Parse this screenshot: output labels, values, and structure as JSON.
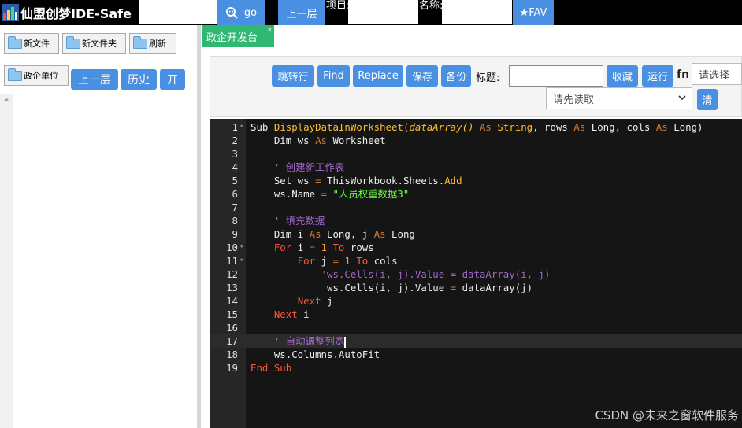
{
  "topbar": {
    "app_title": "仙盟创梦IDE-Safe",
    "go_label": "go",
    "up_label": "上一层",
    "project_label": "项目:",
    "name_label": "名称:",
    "fav_label": "★FAV",
    "search_value": "",
    "project_value": "",
    "name_value": ""
  },
  "sidebar": {
    "new_file": "新文件",
    "new_folder": "新文件夹",
    "refresh": "刷新",
    "folder_item": "政企单位",
    "up_level": "上一层",
    "history": "历史",
    "open": "开"
  },
  "tab": {
    "label": "政企开发台"
  },
  "toolbar": {
    "goto_line": "跳转行",
    "find": "Find",
    "replace": "Replace",
    "save": "保存",
    "backup": "备份",
    "title_label": "标题:",
    "title_value": "",
    "favorite": "收藏",
    "run": "运行",
    "fn": "fn",
    "select_placeholder": "请选择",
    "read_placeholder": "请先读取",
    "clear": "清"
  },
  "editor": {
    "active_line": 17,
    "lines": [
      {
        "n": "1",
        "fold": "▾"
      },
      {
        "n": "2"
      },
      {
        "n": "3"
      },
      {
        "n": "4"
      },
      {
        "n": "5"
      },
      {
        "n": "6"
      },
      {
        "n": "7"
      },
      {
        "n": "8"
      },
      {
        "n": "9"
      },
      {
        "n": "10",
        "fold": "▾"
      },
      {
        "n": "11",
        "fold": "▾"
      },
      {
        "n": "12"
      },
      {
        "n": "13"
      },
      {
        "n": "14"
      },
      {
        "n": "15"
      },
      {
        "n": "16"
      },
      {
        "n": "17"
      },
      {
        "n": "18"
      },
      {
        "n": "19"
      }
    ],
    "code": {
      "l1_sub": "Sub",
      "l1_name": "DisplayDataInWorksheet(",
      "l1_param": "dataArray()",
      "l1_as1": "As",
      "l1_type1": "String",
      "l1_rows": ", rows ",
      "l1_as2": "As",
      "l1_type2": "Long",
      "l1_cols": ", cols ",
      "l1_as3": "As",
      "l1_type3": "Long)",
      "l2_dim": "Dim ws ",
      "l2_as": "As",
      "l2_type": "Worksheet",
      "l4_comment": "' 创建新工作表",
      "l5_set": "Set ws ",
      "l5_eq": "=",
      "l5_obj": " ThisWorkbook.Sheets.",
      "l5_add": "Add",
      "l6_ws": "ws.Name ",
      "l6_eq": "=",
      "l6_str": " \"人员权重数据3\"",
      "l8_comment": "' 填充数据",
      "l9_dim": "Dim i ",
      "l9_as1": "As",
      "l9_mid": " Long, j ",
      "l9_as2": "As",
      "l9_end": " Long",
      "l10_for": "For",
      "l10_i": " i ",
      "l10_eq": "=",
      "l10_one": " 1",
      "l10_to": " To",
      "l10_rows": " rows",
      "l11_for": "For",
      "l11_j": " j ",
      "l11_eq": "=",
      "l11_one": " 1",
      "l11_to": " To",
      "l11_cols": " cols",
      "l12_comment": "'ws.Cells(i, j).Value = dataArray(i, j)",
      "l13_a": "ws.Cells(i, j).Value ",
      "l13_eq": "=",
      "l13_b": " dataArray(j)",
      "l14_next": "Next",
      "l14_j": " j",
      "l15_next": "Next",
      "l15_i": " i",
      "l17_comment": "' 自动调整列宽",
      "l18": "ws.Columns.AutoFit",
      "l19_end": "End",
      "l19_sub": " Sub"
    }
  },
  "watermark": "CSDN @未来之窗软件服务",
  "colors": {
    "accent": "#4a90e2",
    "tab": "#2eb872",
    "editor_bg": "#151515"
  }
}
